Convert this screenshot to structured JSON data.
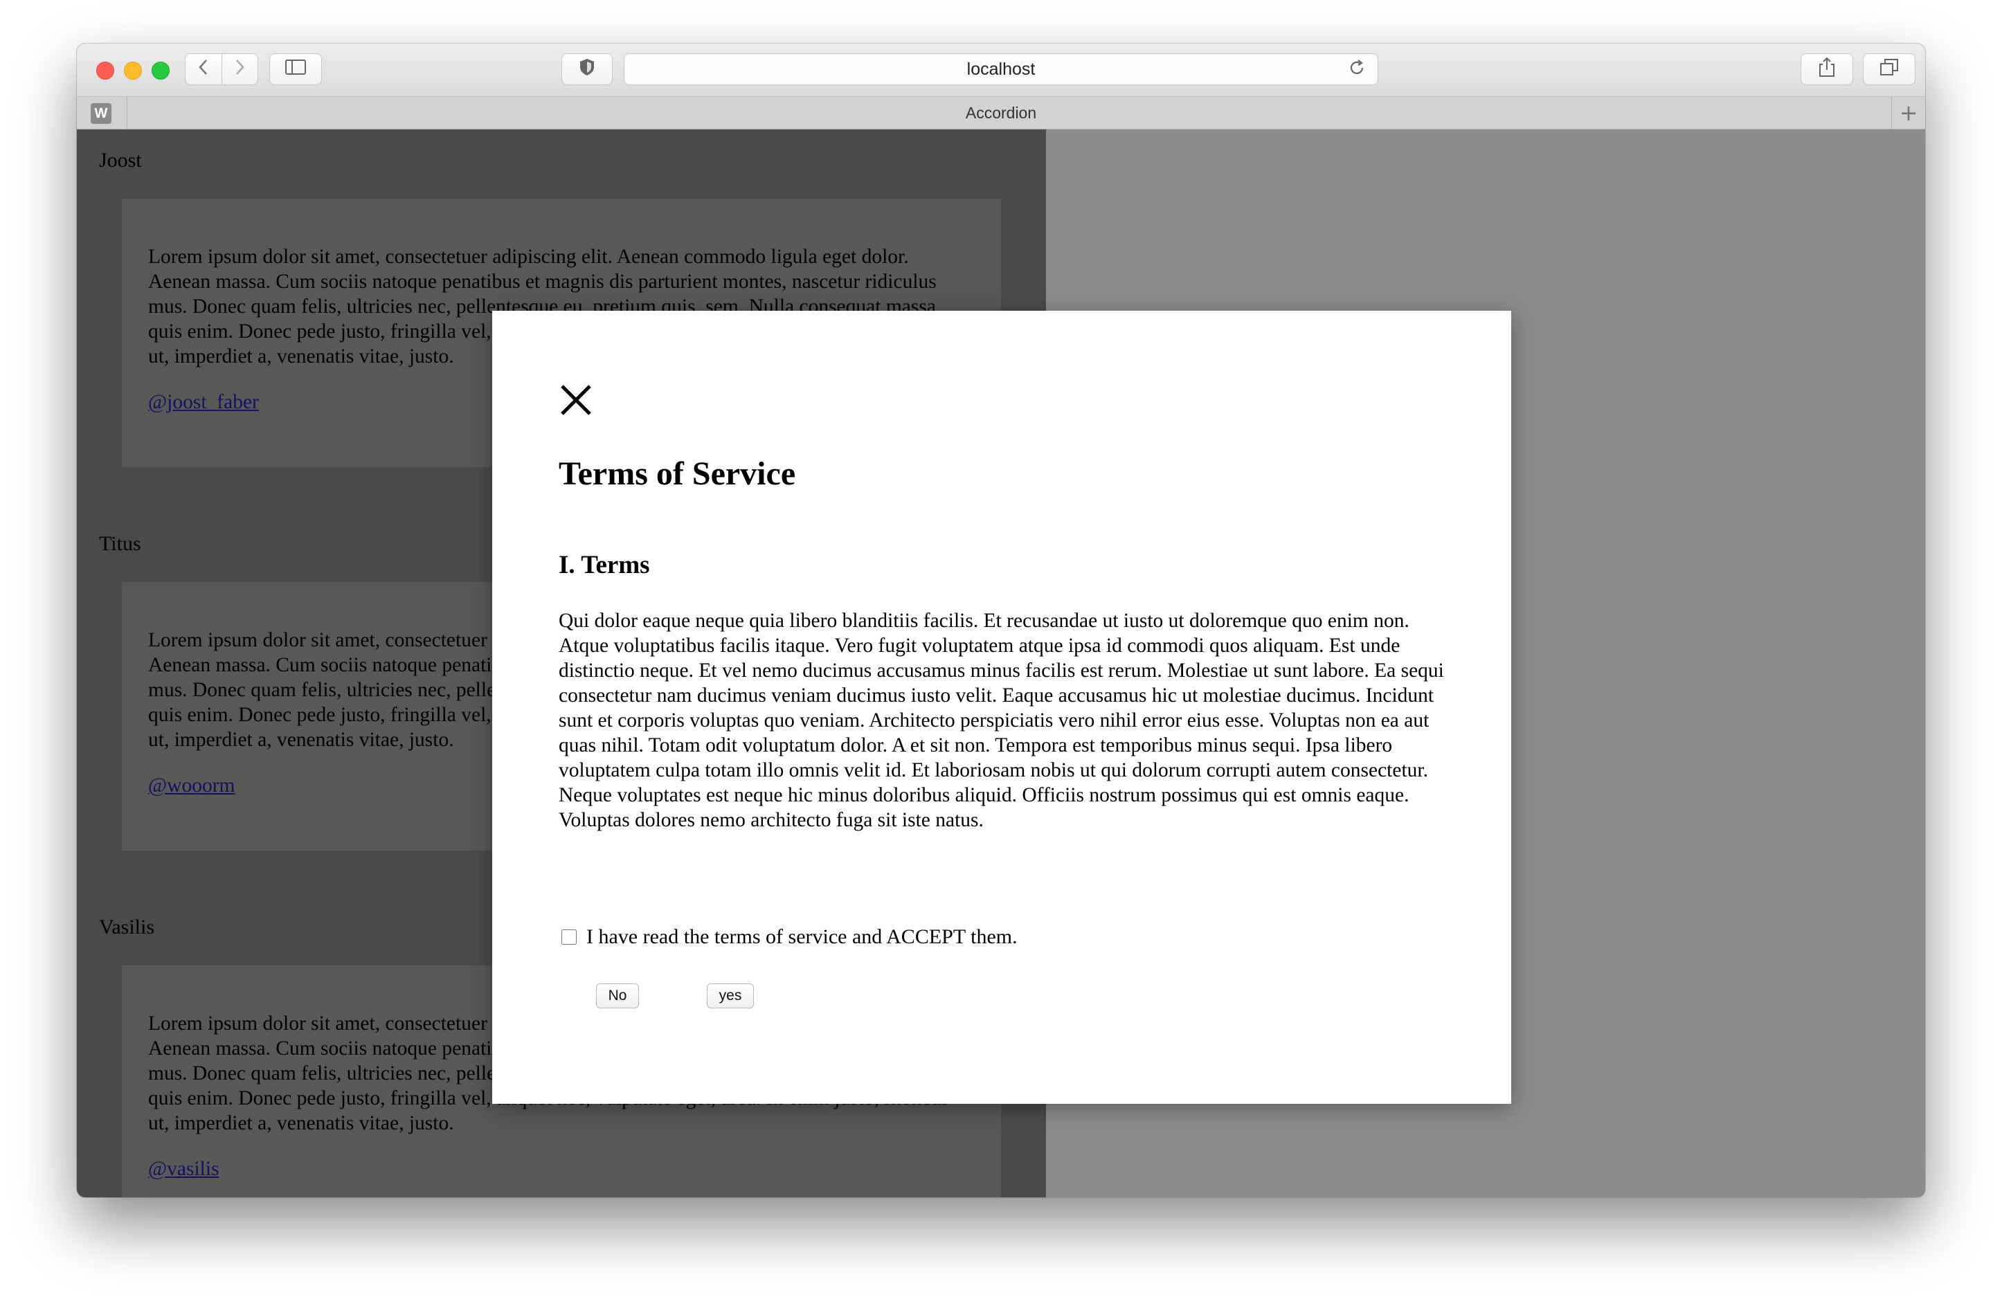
{
  "browser": {
    "url": "localhost",
    "tab_title": "Accordion",
    "favicon_letter": "W",
    "icons": {
      "back": "chevron-left-icon",
      "forward": "chevron-right-icon",
      "sidebar": "sidebar-icon",
      "shield": "shield-icon",
      "reload": "reload-icon",
      "share": "share-icon",
      "tabs": "tabs-overview-icon",
      "new_tab": "plus-icon"
    }
  },
  "accordion": {
    "sections": [
      {
        "name": "Joost",
        "text": "Lorem ipsum dolor sit amet, consectetuer adipiscing elit. Aenean commodo ligula eget dolor. Aenean massa. Cum sociis natoque penatibus et magnis dis parturient montes, nascetur ridiculus mus. Donec quam felis, ultricies nec, pellentesque eu, pretium quis, sem. Nulla consequat massa quis enim. Donec pede justo, fringilla vel, aliquet nec, vulputate eget, arcu. In enim justo, rhoncus ut, imperdiet a, venenatis vitae, justo.",
        "handle": "@joost_faber"
      },
      {
        "name": "Titus",
        "text": "Lorem ipsum dolor sit amet, consectetuer adipiscing elit. Aenean commodo ligula eget dolor. Aenean massa. Cum sociis natoque penatibus et magnis dis parturient montes, nascetur ridiculus mus. Donec quam felis, ultricies nec, pellentesque eu, pretium quis, sem. Nulla consequat massa quis enim. Donec pede justo, fringilla vel, aliquet nec, vulputate eget, arcu. In enim justo, rhoncus ut, imperdiet a, venenatis vitae, justo.",
        "handle": "@wooorm"
      },
      {
        "name": "Vasilis",
        "text": "Lorem ipsum dolor sit amet, consectetuer adipiscing elit. Aenean commodo ligula eget dolor. Aenean massa. Cum sociis natoque penatibus et magnis dis parturient montes, nascetur ridiculus mus. Donec quam felis, ultricies nec, pellentesque eu, pretium quis, sem. Nulla consequat massa quis enim. Donec pede justo, fringilla vel, aliquet nec, vulputate eget, arcu. In enim justo, rhoncus ut, imperdiet a, venenatis vitae, justo.",
        "handle": "@vasilis"
      }
    ]
  },
  "modal": {
    "close_icon": "close-icon",
    "title": "Terms of Service",
    "section_heading": "I. Terms",
    "body": "Qui dolor eaque neque quia libero blanditiis facilis. Et recusandae ut iusto ut doloremque quo enim non. Atque voluptatibus facilis itaque. Vero fugit voluptatem atque ipsa id commodi quos aliquam. Est unde distinctio neque. Et vel nemo ducimus accusamus minus facilis est rerum. Molestiae ut sunt labore. Ea sequi consectetur nam ducimus veniam ducimus iusto velit. Eaque accusamus hic ut molestiae ducimus. Incidunt sunt et corporis voluptas quo veniam. Architecto perspiciatis vero nihil error eius esse. Voluptas non ea aut quas nihil. Totam odit voluptatum dolor. A et sit non. Tempora est temporibus minus sequi. Ipsa libero voluptatem culpa totam illo omnis velit id. Et laboriosam nobis ut qui dolorum corrupti autem consectetur. Neque voluptates est neque hic minus doloribus aliquid. Officiis nostrum possimus qui est omnis eaque. Voluptas dolores nemo architecto fuga sit iste natus.",
    "accept_label": "I have read the terms of service and ACCEPT them.",
    "accept_checked": false,
    "no_label": "No",
    "yes_label": "yes"
  }
}
